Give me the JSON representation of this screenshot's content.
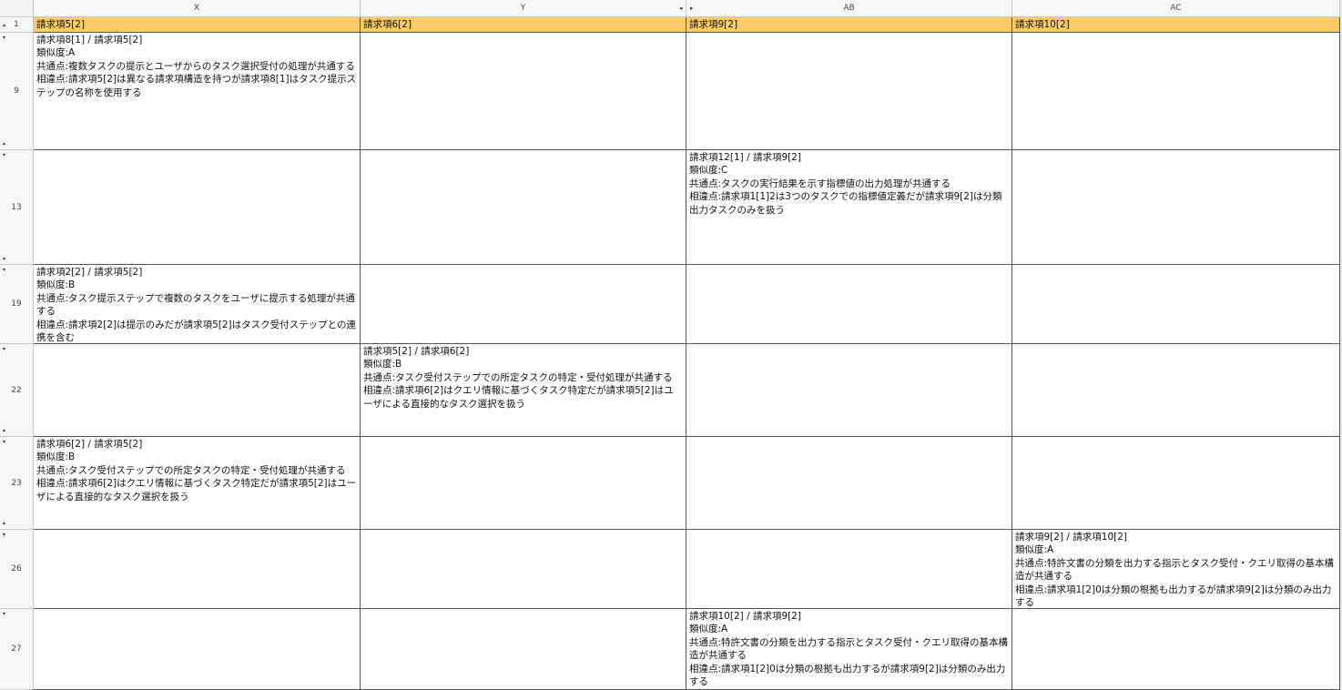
{
  "columns": [
    "X",
    "Y",
    "AB",
    "AC"
  ],
  "header_row": {
    "number": "1",
    "cells": [
      "請求項5[2]",
      "請求項6[2]",
      "請求項9[2]",
      "請求項10[2]"
    ]
  },
  "rows": [
    {
      "number": "9",
      "cells": [
        "請求項8[1] / 請求項5[2]\n類似度:A\n共通点:複数タスクの提示とユーザからのタスク選択受付の処理が共通する\n相違点:請求項5[2]は異なる請求項構造を持つが請求項8[1]はタスク提示ステップの名称を使用する",
        "",
        "",
        ""
      ]
    },
    {
      "number": "13",
      "cells": [
        "",
        "",
        "請求項12[1] / 請求項9[2]\n類似度:C\n共通点:タスクの実行結果を示す指標値の出力処理が共通する\n相違点:請求項1[1]2は3つのタスクでの指標値定義だが請求項9[2]は分類出力タスクのみを扱う",
        ""
      ]
    },
    {
      "number": "19",
      "cells": [
        "請求項2[2] / 請求項5[2]\n類似度:B\n共通点:タスク提示ステップで複数のタスクをユーザに提示する処理が共通する\n相違点:請求項2[2]は提示のみだが請求項5[2]はタスク受付ステップとの連携を含む",
        "",
        "",
        ""
      ]
    },
    {
      "number": "22",
      "cells": [
        "",
        "請求項5[2] / 請求項6[2]\n類似度:B\n共通点:タスク受付ステップでの所定タスクの特定・受付処理が共通する\n相違点:請求項6[2]はクエリ情報に基づくタスク特定だが請求項5[2]はユーザによる直接的なタスク選択を扱う",
        "",
        ""
      ]
    },
    {
      "number": "23",
      "cells": [
        "請求項6[2] / 請求項5[2]\n類似度:B\n共通点:タスク受付ステップでの所定タスクの特定・受付処理が共通する\n相違点:請求項6[2]はクエリ情報に基づくタスク特定だが請求項5[2]はユーザによる直接的なタスク選択を扱う",
        "",
        "",
        ""
      ]
    },
    {
      "number": "26",
      "cells": [
        "",
        "",
        "",
        "請求項9[2] / 請求項10[2]\n類似度:A\n共通点:特許文書の分類を出力する指示とタスク受付・クエリ取得の基本構造が共通する\n相違点:請求項1[2]0は分類の根拠も出力するが請求項9[2]は分類のみ出力する"
      ]
    },
    {
      "number": "27",
      "cells": [
        "",
        "",
        "請求項10[2] / 請求項9[2]\n類似度:A\n共通点:特許文書の分類を出力する指示とタスク受付・クエリ取得の基本構造が共通する\n相違点:請求項1[2]0は分類の根拠も出力するが請求項9[2]は分類のみ出力する",
        ""
      ]
    }
  ],
  "colors": {
    "header_fill": "#f9cc66",
    "grid_line": "#555555",
    "heading_bg": "#f7f7f7"
  }
}
